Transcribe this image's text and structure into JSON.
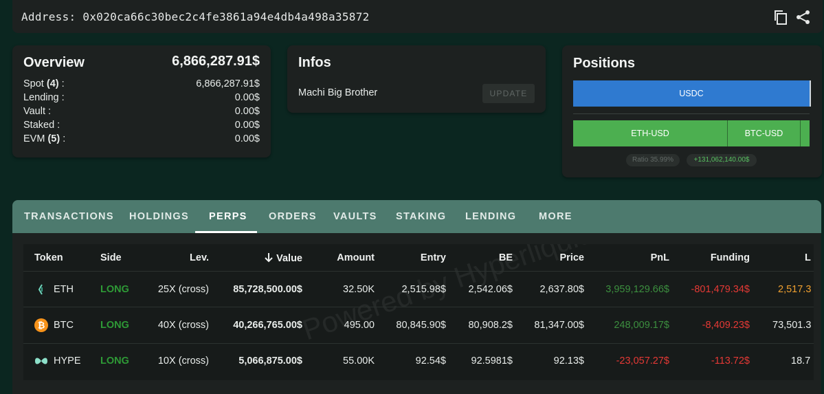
{
  "address": {
    "text": "Address: 0x020ca66c30bec2c4fe3861a94e4db4a498a35872"
  },
  "overview": {
    "title": "Overview",
    "total": "6,866,287.91$",
    "rows": [
      {
        "label_pre": "Spot ",
        "label_count": "(4)",
        "label_post": " :",
        "value": "6,866,287.91$"
      },
      {
        "label_pre": "Lending :",
        "label_count": "",
        "label_post": "",
        "value": "0.00$"
      },
      {
        "label_pre": "Vault :",
        "label_count": "",
        "label_post": "",
        "value": "0.00$"
      },
      {
        "label_pre": "Staked :",
        "label_count": "",
        "label_post": "",
        "value": "0.00$"
      },
      {
        "label_pre": "EVM ",
        "label_count": "(5)",
        "label_post": " :",
        "value": "0.00$"
      }
    ]
  },
  "infos": {
    "title": "Infos",
    "name": "Machi Big Brother",
    "update_label": "UPDATE"
  },
  "positions": {
    "title": "Positions",
    "spot_bar_label": "USDC",
    "perp_bars": [
      {
        "label": "ETH-USD"
      },
      {
        "label": "BTC-USD"
      }
    ],
    "ratio_label": "Ratio 35.99%",
    "total_label": "+131,062,140.00$",
    "colors": {
      "spot": "#2f7ad0",
      "perp": "#4caf50"
    }
  },
  "tabs": [
    "TRANSACTIONS",
    "HOLDINGS",
    "PERPS",
    "ORDERS",
    "VAULTS",
    "STAKING",
    "LENDING",
    "MORE"
  ],
  "active_tab": "PERPS",
  "table": {
    "headers": {
      "token": "Token",
      "side": "Side",
      "lev": "Lev.",
      "value": "Value",
      "amount": "Amount",
      "entry": "Entry",
      "be": "BE",
      "price": "Price",
      "pnl": "PnL",
      "funding": "Funding",
      "liq": "L"
    },
    "sort_icon": "arrow-down-icon",
    "watermark": "Powered by Hyperliquid",
    "rows": [
      {
        "token": "ETH",
        "icon": "eth-icon",
        "side": "LONG",
        "lev": "25X (cross)",
        "value": "85,728,500.00$",
        "amount": "32.50K",
        "entry": "2,515.98$",
        "be": "2,542.06$",
        "price": "2,637.80$",
        "pnl": "3,959,129.66$",
        "funding": "-801,479.34$",
        "liq": "2,517.3"
      },
      {
        "token": "BTC",
        "icon": "btc-icon",
        "side": "LONG",
        "lev": "40X (cross)",
        "value": "40,266,765.00$",
        "amount": "495.00",
        "entry": "80,845.90$",
        "be": "80,908.2$",
        "price": "81,347.00$",
        "pnl": "248,009.17$",
        "funding": "-8,409.23$",
        "liq": "73,501.3"
      },
      {
        "token": "HYPE",
        "icon": "hype-icon",
        "side": "LONG",
        "lev": "10X (cross)",
        "value": "5,066,875.00$",
        "amount": "55.00K",
        "entry": "92.54$",
        "be": "92.5981$",
        "price": "92.13$",
        "pnl": "-23,057.27$",
        "funding": "-113.72$",
        "liq": "18.7"
      }
    ],
    "colors": {
      "long": "#2e9a36",
      "pnl_pos": "#3c8f3f",
      "pnl_neg": "#e53935",
      "funding_neg": "#e53935",
      "liq_warn": "#f0a030"
    }
  }
}
